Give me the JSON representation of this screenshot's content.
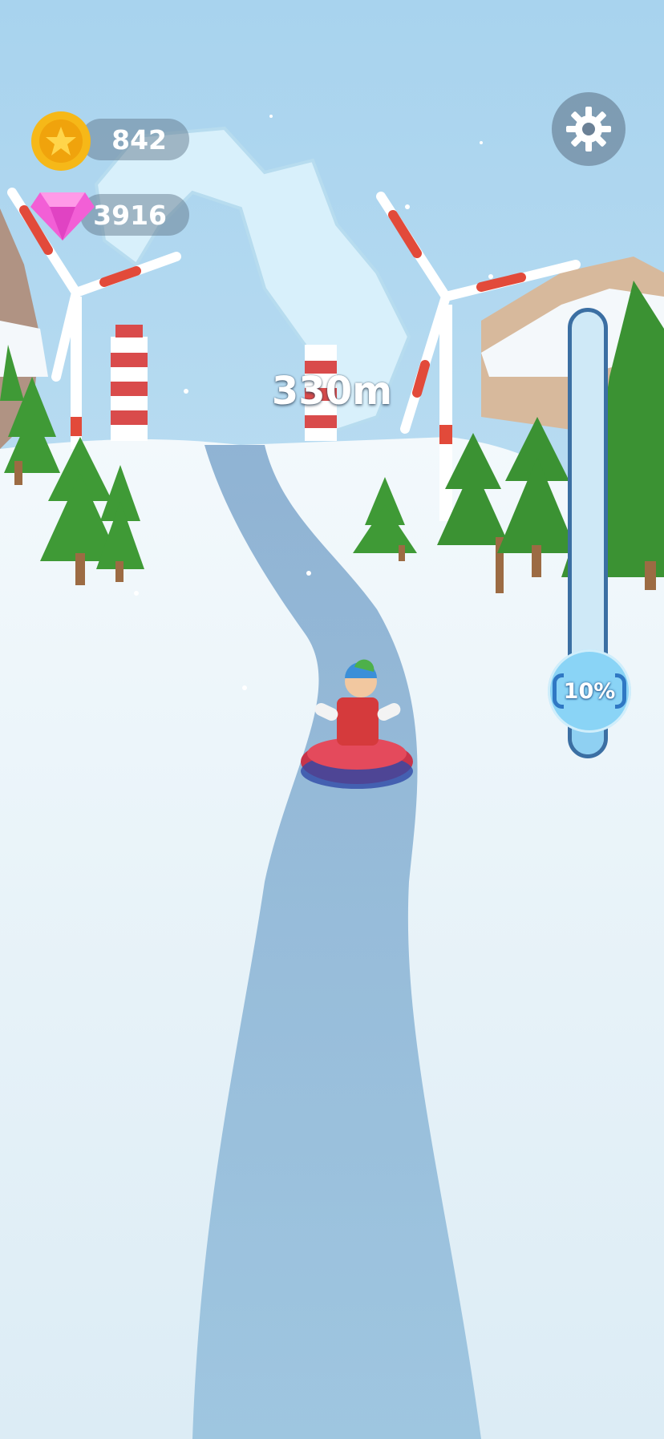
{
  "currencies": {
    "coins": {
      "value": "842",
      "icon": "star-coin-icon",
      "color": "#f6b818"
    },
    "gems": {
      "value": "3916",
      "icon": "pink-gem-icon",
      "color": "#f25fd6"
    }
  },
  "settings": {
    "icon": "gear-icon"
  },
  "distance": {
    "label": "330m"
  },
  "progress": {
    "label": "10%",
    "fraction": 0.1
  },
  "colors": {
    "track_border": "#3b6fa3",
    "knob": "#8ad4f6",
    "sky": "#a9d5ef",
    "snow": "#e6f3f9"
  }
}
